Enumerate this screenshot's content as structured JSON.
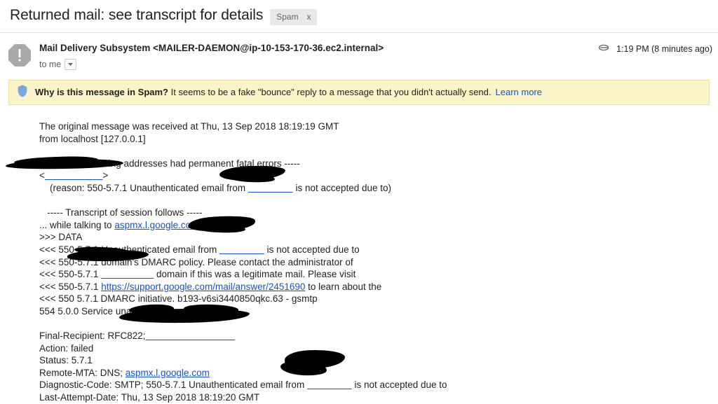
{
  "subject": {
    "title": "Returned mail: see transcript for details",
    "label": "Spam",
    "label_close": "x"
  },
  "header": {
    "sender_name": "Mail Delivery Subsystem",
    "sender_email": "<MAILER-DAEMON@ip-10-153-170-36.ec2.internal>",
    "recipients": "to me",
    "attachment_icon": "paperclip-icon",
    "timestamp": "1:19 PM (8 minutes ago)"
  },
  "spam_banner": {
    "icon": "shield-icon",
    "question": "Why is this message in Spam?",
    "explanation": "It seems to be a fake \"bounce\" reply to a message that you didn't actually send.",
    "link": "Learn more",
    "background": "#fdf3c8"
  },
  "body": {
    "line1": "The original message was received at Thu, 13 Sep 2018 18:19:19 GMT",
    "line2": "from localhost [127.0.0.1]",
    "line3": "   ----- The following addresses had permanent fatal errors -----",
    "line4_prefix": "<",
    "line4_redacted_address": "",
    "line4_suffix": ">",
    "line5": "    (reason: 550-5.7.1 Unauthenticated email from ",
    "line5_tail": " is not accepted due to)",
    "line6": "   ----- Transcript of session follows -----",
    "line7_prefix": "... while talking to ",
    "line7_link": "aspmx.l.google.com",
    "line7_suffix": ".:",
    "line8": ">>> DATA",
    "line9_prefix": "<<< 550-5.7.1 Unauthenticated email from ",
    "line9_suffix": " is not accepted due to",
    "line10": "<<< 550-5.7.1 domain's DMARC policy. Please contact the administrator of",
    "line11_prefix": "<<< 550-5.7.1 ",
    "line11_suffix": " domain if this was a legitimate mail. Please visit",
    "line12_prefix": "<<< 550-5.7.1 ",
    "line12_link": "https://support.google.com/mail/answer/2451690",
    "line12_suffix": " to learn about the",
    "line13": "<<< 550 5.7.1 DMARC initiative. b193-v6si3440850qkc.63 - gsmtp",
    "line14": "554 5.0.0 Service unavailable",
    "line15_prefix": "Final-Recipient: RFC822;",
    "line16": "Action: failed",
    "line17": "Status: 5.7.1",
    "line18_prefix": "Remote-MTA: DNS; ",
    "line18_link": "aspmx.l.google.com",
    "line19_prefix": "Diagnostic-Code: SMTP; 550-5.7.1 Unauthenticated email from ",
    "line19_suffix": " is not accepted due to",
    "line20": "Last-Attempt-Date: Thu, 13 Sep 2018 18:19:20 GMT"
  }
}
